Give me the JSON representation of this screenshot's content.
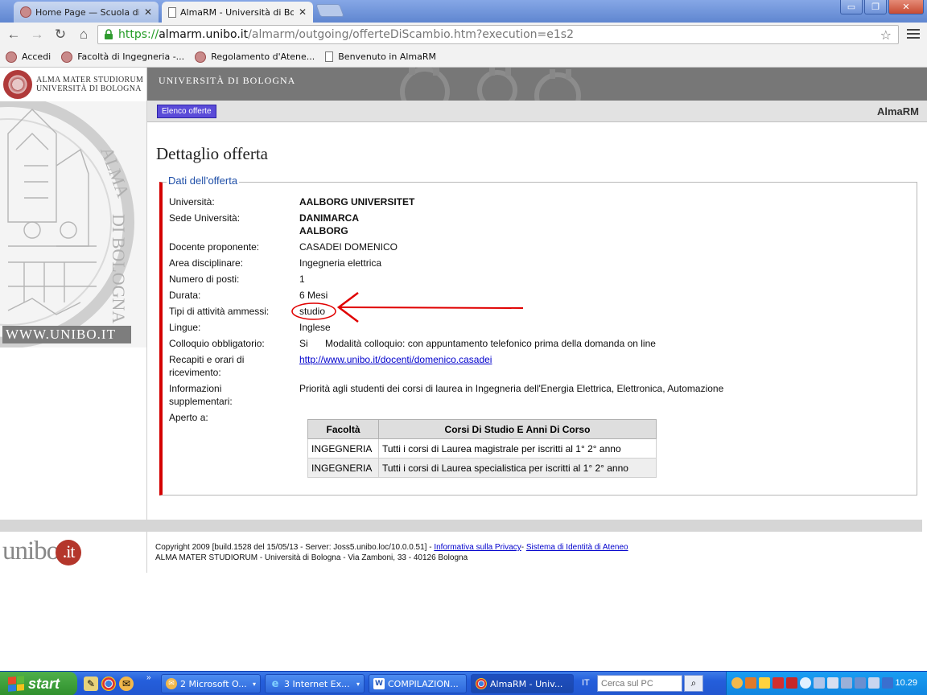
{
  "browser": {
    "tabs": [
      {
        "label": "Home Page — Scuola di Inge",
        "active": false
      },
      {
        "label": "AlmaRM - Università di Bologn",
        "active": true
      }
    ],
    "window_controls": {
      "minimize": "▭",
      "maximize": "❐",
      "close": "✕"
    },
    "url": {
      "scheme": "https://",
      "host": "almarm.unibo.it",
      "path": "/almarm/outgoing/offerteDiScambio.htm?execution=e1s2"
    },
    "bookmarks": [
      {
        "label": "Accedi",
        "icon": "seal-icon"
      },
      {
        "label": "Facoltà di Ingegneria -...",
        "icon": "seal-icon"
      },
      {
        "label": "Regolamento d'Atene...",
        "icon": "seal-icon"
      },
      {
        "label": "Benvenuto in AlmaRM",
        "icon": "page-icon"
      }
    ]
  },
  "site": {
    "logo_line1": "ALMA MATER STUDIORUM",
    "logo_line2": "UNIVERSITÀ DI BOLOGNA",
    "header_title": "UNIVERSITÀ DI BOLOGNA",
    "www_label": "WWW.UNIBO.IT",
    "elenco_button": "Elenco offerte",
    "app_name": "AlmaRM"
  },
  "offer": {
    "page_title": "Dettaglio offerta",
    "legend": "Dati dell'offerta",
    "fields": {
      "universita_label": "Università:",
      "universita_value": "AALBORG UNIVERSITET",
      "sede_label": "Sede Università:",
      "sede_country": "DANIMARCA",
      "sede_city": "AALBORG",
      "docente_label": "Docente proponente:",
      "docente_value": "CASADEI DOMENICO",
      "area_label": "Area disciplinare:",
      "area_value": "Ingegneria elettrica",
      "posti_label": "Numero di posti:",
      "posti_value": "1",
      "durata_label": "Durata:",
      "durata_value": "6 Mesi",
      "tipi_label": "Tipi di attività ammessi:",
      "tipi_value": "studio",
      "lingue_label": "Lingue:",
      "lingue_value": "Inglese",
      "colloquio_label": "Colloquio obbligatorio:",
      "colloquio_value": "Si",
      "colloquio_mode": "Modalità colloquio: con appuntamento telefonico prima della domanda on line",
      "recapiti_label_1": "Recapiti e orari di",
      "recapiti_label_2": "ricevimento:",
      "recapiti_link": "http://www.unibo.it/docenti/domenico.casadei",
      "info_label_1": "Informazioni",
      "info_label_2": "supplementari:",
      "info_value": "Priorità agli studenti dei corsi di laurea in Ingegneria dell'Energia Elettrica, Elettronica, Automazione",
      "aperto_label": "Aperto a:"
    },
    "table": {
      "headers": [
        "Facoltà",
        "Corsi Di Studio E Anni Di Corso"
      ],
      "rows": [
        [
          "INGEGNERIA",
          "Tutti i corsi di Laurea magistrale per iscritti al 1° 2° anno"
        ],
        [
          "INGEGNERIA",
          "Tutti i corsi di Laurea specialistica per iscritti al 1° 2° anno"
        ]
      ]
    },
    "annotation_color": "#e00000"
  },
  "footer": {
    "logo_text": "unibo",
    "logo_dot": ".it",
    "line1": "Copyright 2009 [build.1528 del 15/05/13 - Server: Joss5.unibo.loc/10.0.0.51] - ",
    "privacy_link": "Informativa sulla Privacy",
    "separator": "- ",
    "identity_link": "Sistema di Identità di Ateneo ",
    "line2": "ALMA MATER STUDIORUM - Università di Bologna - Via Zamboni, 33 - 40126 Bologna"
  },
  "taskbar": {
    "start_label": "start",
    "tasks": [
      {
        "label": "2 Microsoft O...",
        "icon": "outlook-icon"
      },
      {
        "label": "3 Internet Ex...",
        "icon": "ie-icon"
      },
      {
        "label": "COMPILAZION...",
        "icon": "word-icon"
      },
      {
        "label": "AlmaRM - Univ...",
        "icon": "chrome-icon"
      }
    ],
    "lang": "IT",
    "search_placeholder": "Cerca sul PC",
    "clock": "10.29",
    "quick_more": "»"
  }
}
